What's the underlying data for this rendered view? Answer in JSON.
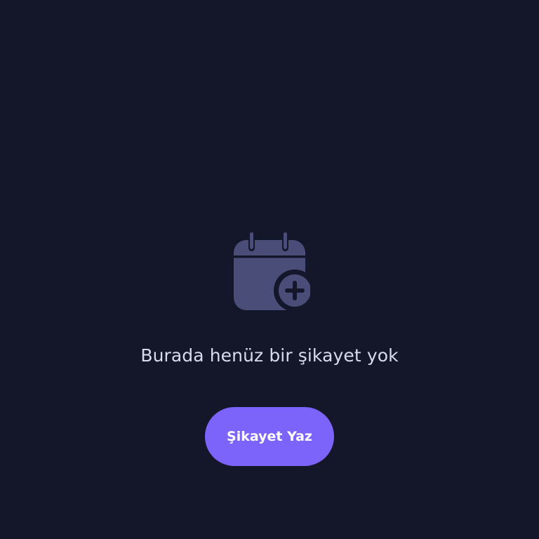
{
  "empty_state": {
    "icon": "calendar-add-icon",
    "message": "Burada henüz bir şikayet yok",
    "action_label": "Şikayet Yaz"
  },
  "colors": {
    "background": "#14162A",
    "icon": "#4A4D78",
    "message_text": "#D8DAEE",
    "accent": "#7C63FA",
    "button_text": "#FFFFFF"
  }
}
